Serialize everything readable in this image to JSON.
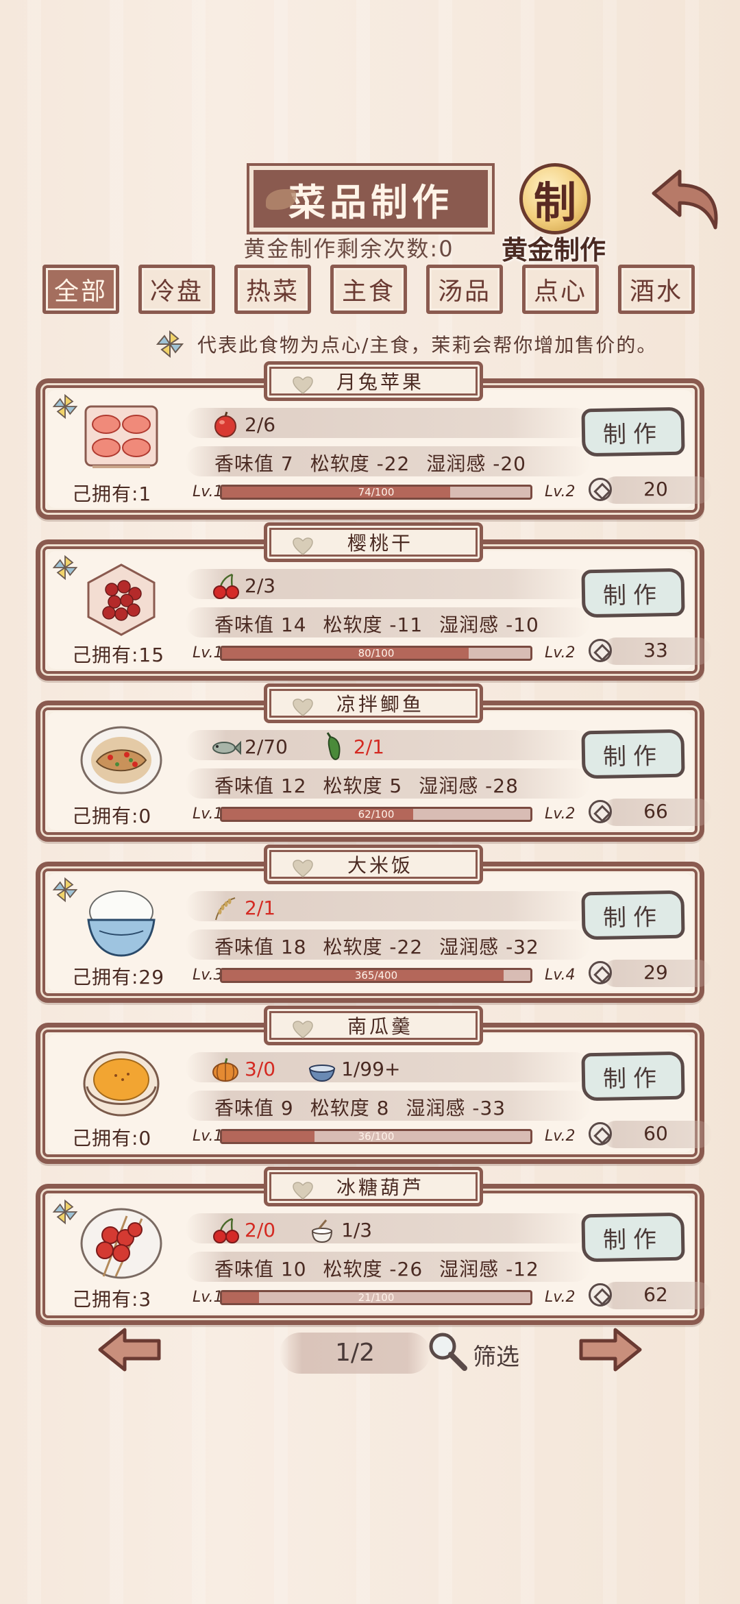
{
  "header": {
    "title": "菜品制作",
    "gold_remaining": "黄金制作剩余次数:0",
    "gold_coin_char": "制",
    "gold_make_label": "黄金制作"
  },
  "tabs": [
    "全部",
    "冷盘",
    "热菜",
    "主食",
    "汤品",
    "点心",
    "酒水"
  ],
  "active_tab": "全部",
  "notice": "代表此食物为点心/主食，茉莉会帮你增加售价的。",
  "recipes": [
    {
      "name": "月兔苹果",
      "owned": "己拥有:1",
      "ingredients": [
        {
          "icon": "apple-icon",
          "count": "2/6",
          "short": false
        }
      ],
      "stats": [
        "香味值 7",
        "松软度 -22",
        "湿润感 -20"
      ],
      "level": "Lv.1",
      "next_level": "Lv.2",
      "xp_text": "74/100",
      "xp": 0.74,
      "make": "制作",
      "price": "20",
      "pinwheel": true
    },
    {
      "name": "樱桃干",
      "owned": "己拥有:15",
      "ingredients": [
        {
          "icon": "cherry-icon",
          "count": "2/3",
          "short": false
        }
      ],
      "stats": [
        "香味值 14",
        "松软度 -11",
        "湿润感 -10"
      ],
      "level": "Lv.1",
      "next_level": "Lv.2",
      "xp_text": "80/100",
      "xp": 0.8,
      "make": "制作",
      "price": "33",
      "pinwheel": true
    },
    {
      "name": "凉拌鲫鱼",
      "owned": "己拥有:0",
      "ingredients": [
        {
          "icon": "fish-icon",
          "count": "2/70",
          "short": false
        },
        {
          "icon": "green-pepper-icon",
          "count": "2/1",
          "short": true
        }
      ],
      "stats": [
        "香味值 12",
        "松软度 5",
        "湿润感 -28"
      ],
      "level": "Lv.1",
      "next_level": "Lv.2",
      "xp_text": "62/100",
      "xp": 0.62,
      "make": "制作",
      "price": "66",
      "pinwheel": false
    },
    {
      "name": "大米饭",
      "owned": "己拥有:29",
      "ingredients": [
        {
          "icon": "rice-stalk-icon",
          "count": "2/1",
          "short": true
        }
      ],
      "stats": [
        "香味值 18",
        "松软度 -22",
        "湿润感 -32"
      ],
      "level": "Lv.3",
      "next_level": "Lv.4",
      "xp_text": "365/400",
      "xp": 0.9125,
      "make": "制作",
      "price": "29",
      "pinwheel": true
    },
    {
      "name": "南瓜羹",
      "owned": "己拥有:0",
      "ingredients": [
        {
          "icon": "pumpkin-icon",
          "count": "3/0",
          "short": true
        },
        {
          "icon": "bowl-icon",
          "count": "1/99+",
          "short": false
        }
      ],
      "stats": [
        "香味值 9",
        "松软度 8",
        "湿润感 -33"
      ],
      "level": "Lv.1",
      "next_level": "Lv.2",
      "xp_text": "36/100",
      "xp": 0.3,
      "make": "制作",
      "price": "60",
      "pinwheel": false
    },
    {
      "name": "冰糖葫芦",
      "owned": "己拥有:3",
      "ingredients": [
        {
          "icon": "cherry-icon",
          "count": "2/0",
          "short": true
        },
        {
          "icon": "sugar-pot-icon",
          "count": "1/3",
          "short": false
        }
      ],
      "stats": [
        "香味值 10",
        "松软度 -26",
        "湿润感 -12"
      ],
      "level": "Lv.1",
      "next_level": "Lv.2",
      "xp_text": "21/100",
      "xp": 0.12,
      "make": "制作",
      "price": "62",
      "pinwheel": true
    }
  ],
  "pagination": {
    "page": "1/2",
    "filter": "筛选"
  },
  "colors": {
    "frame": "#8a5a4f",
    "short": "#d42a22",
    "xp_fill": "#b4675a",
    "button": "#dfeae6"
  }
}
